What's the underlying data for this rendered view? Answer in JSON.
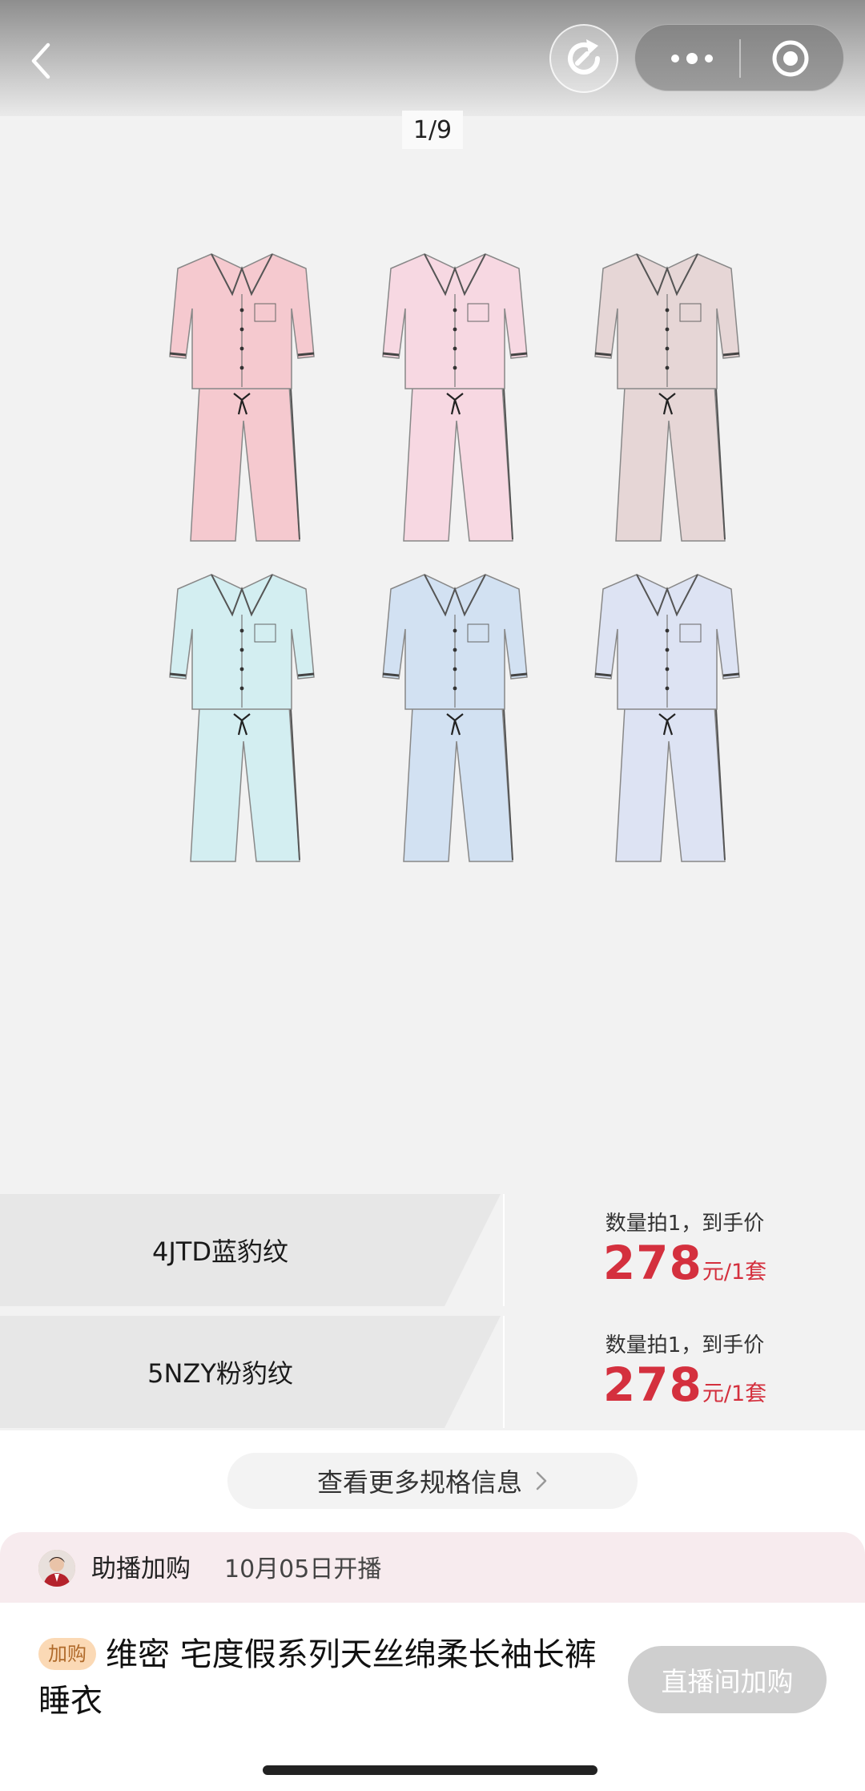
{
  "nav": {
    "back_icon": "chevron-left-icon",
    "share_icon": "share-arrow-icon",
    "more_icon": "more-dots-icon",
    "close_icon": "target-circle-icon"
  },
  "gallery": {
    "pager": "1/9",
    "colors": [
      "#f5c9cf",
      "#f7d8e2",
      "#e6d6d6",
      "#d3eef1",
      "#d2e1f2",
      "#dde3f3"
    ]
  },
  "specs": [
    {
      "name": "4JTD蓝豹纹",
      "note": "数量拍1，到手价",
      "price": "278",
      "unit": "元/1套"
    },
    {
      "name": "5NZY粉豹纹",
      "note": "数量拍1，到手价",
      "price": "278",
      "unit": "元/1套"
    }
  ],
  "more_specs": {
    "label": "查看更多规格信息",
    "icon": "chevron-right-icon"
  },
  "live": {
    "title": "助播加购",
    "time": "10月05日开播"
  },
  "product": {
    "badge": "加购",
    "title": "维密 宅度假系列天丝绵柔长袖长裤睡衣",
    "buy_button": "直播间加购"
  },
  "theme": {
    "price_color": "#d4303e",
    "live_bg": "#f7ebee",
    "badge_bg": "#fbd9b5"
  }
}
